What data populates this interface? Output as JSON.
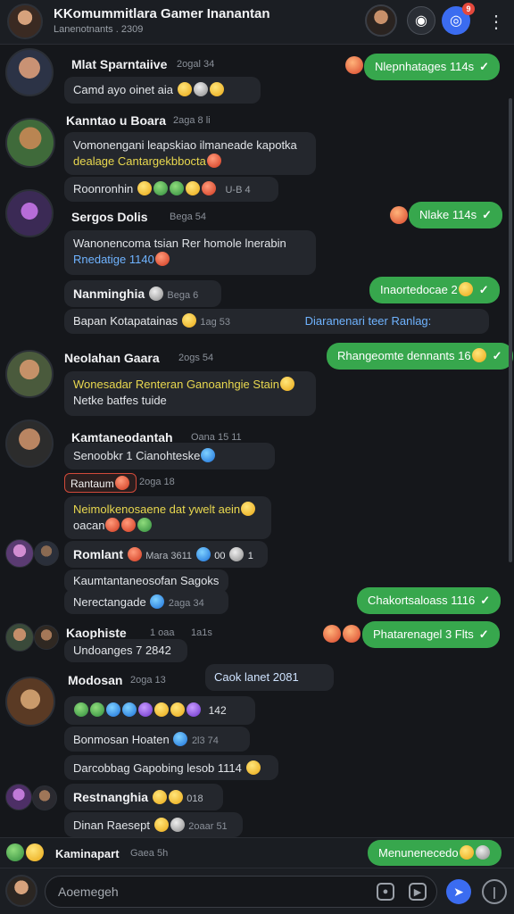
{
  "header": {
    "title": "KKomummitlara Gamer Inanantan",
    "subtitle": "Lanenotnants . 2309",
    "game_icon": "gamepad-icon",
    "notif_icon": "notification-icon",
    "notif_count": "9",
    "more_icon": "more-vertical-icon"
  },
  "messages": [
    {
      "name": "Mlat Sparntaiive",
      "meta": "2ogal 34",
      "text": "Camd ayo oinet aia"
    },
    {
      "name": "Kanntao u Boara",
      "meta": "2aga 8 li",
      "text1": "Vomonengani leapskiao ilmaneade kapotka",
      "text2": "dealage Cantargekbbocta",
      "reactions": "Roonronhin",
      "reactions_meta": "U-B 4"
    },
    {
      "name": "Sergos Dolis",
      "meta": "Bega 54",
      "text1": "Wanonencoma tsian Rer homole lnerabin",
      "text2": "Rnedatige 1140"
    },
    {
      "name": "Nanminghia",
      "meta": "Bega 6",
      "system": "Bapan Kotapatainas",
      "system_meta": "1ag 53",
      "system_link": "Diaranenari teer Ranlag:"
    },
    {
      "name": "Neolahan Gaara",
      "meta": "2ogs 54",
      "text1": "Wonesadar Renteran Ganoanhgie Stain",
      "text2": "Netke batfes tuide"
    },
    {
      "name": "Kamtaneodantah",
      "meta": "Oana 15 11",
      "text1": "Senoobkr 1 Cianohteske"
    },
    {
      "name": "Rantaum",
      "meta": "2oga 18",
      "text1": "Neimolkenosaene dat ywelt aein",
      "text2": "oacan"
    },
    {
      "name": "Romlant",
      "meta": "Mara 3611",
      "extra": "00",
      "extra2": "1",
      "text1": "Kaumtantaneosofan Sagoks",
      "text2": "Nerectangade",
      "text2_meta": "2aga 34"
    },
    {
      "name": "Kaophiste",
      "meta": "1 oaa",
      "meta2": "1a1s",
      "text1": "Undoanges 7 2842"
    },
    {
      "name": "Modosan",
      "meta": "2oga 13",
      "side": "Caok lanet 2081",
      "emojis_meta": "142",
      "text1": "Bonmosan Hoaten",
      "text1_meta": "2l3 74",
      "text2": "Darcobbag Gapobing lesob 1114"
    },
    {
      "name": "Restnanghia",
      "meta": "018",
      "text1": "Dinan Raesept",
      "text1_meta": "2oaar 51"
    }
  ],
  "outgoing": {
    "o1": "Nlepnhatages 114s",
    "o2": "Nlake 114s",
    "o3": "Inaortedocae 2",
    "o4": "Rhangeomte dennants 16",
    "o5": "Chakortsaloass 1116",
    "o6": "Phatarenagel 3 Flts"
  },
  "pinned": {
    "name": "Kaminapart",
    "meta": "Gaea 5h",
    "out": "Menunenecedo"
  },
  "composer": {
    "placeholder": "Aoemegeh",
    "send_icon": "send-icon",
    "mic_icon": "info-icon"
  }
}
